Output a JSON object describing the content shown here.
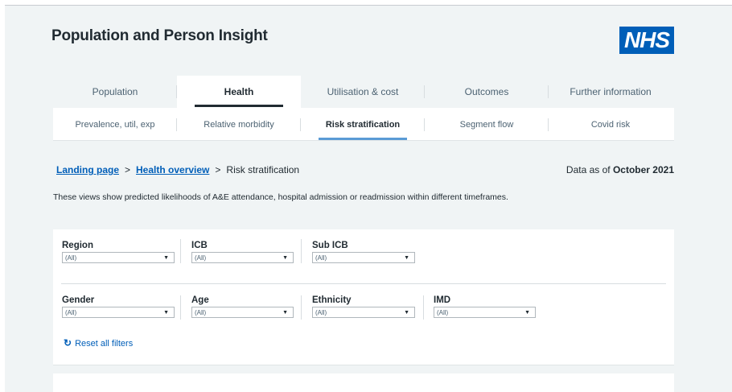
{
  "app": {
    "title": "Population and Person Insight",
    "logo_text": "NHS",
    "brand_color": "#005eb8"
  },
  "main_tabs": [
    {
      "label": "Population"
    },
    {
      "label": "Health",
      "active": true
    },
    {
      "label": "Utilisation & cost"
    },
    {
      "label": "Outcomes"
    },
    {
      "label": "Further information"
    }
  ],
  "sub_tabs": [
    {
      "label": "Prevalence, util, exp"
    },
    {
      "label": "Relative morbidity"
    },
    {
      "label": "Risk stratification",
      "active": true
    },
    {
      "label": "Segment flow"
    },
    {
      "label": "Covid risk"
    }
  ],
  "breadcrumb": {
    "items": [
      "Landing page",
      "Health overview"
    ],
    "separator": ">",
    "current": "Risk stratification"
  },
  "data_asof": {
    "prefix": "Data as of",
    "value": "October 2021"
  },
  "description": "These views show predicted likelihoods of A&E attendance, hospital admission or readmission within different timeframes.",
  "filters": {
    "region": {
      "label": "Region",
      "value": "(All)"
    },
    "icb": {
      "label": "ICB",
      "value": "(All)"
    },
    "sub_icb": {
      "label": "Sub ICB",
      "value": "(All)"
    },
    "gender": {
      "label": "Gender",
      "value": "(All)"
    },
    "age": {
      "label": "Age",
      "value": "(All)"
    },
    "ethnicity": {
      "label": "Ethnicity",
      "value": "(All)"
    },
    "imd": {
      "label": "IMD",
      "value": "(All)"
    },
    "caret": "▼",
    "reset_icon": "↻",
    "reset_label": "Reset all filters"
  }
}
